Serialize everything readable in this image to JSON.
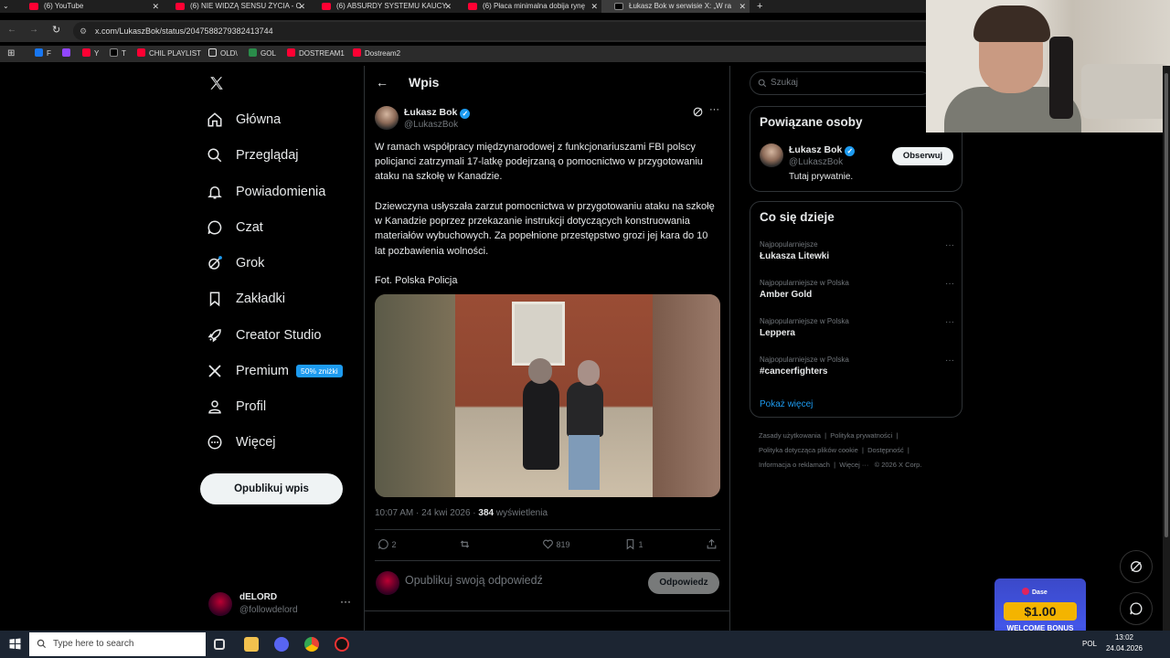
{
  "browser": {
    "tabs": [
      {
        "title": "(6) YouTube"
      },
      {
        "title": "(6) NIE WIDZĄ SENSU ŻYCIA - C"
      },
      {
        "title": "(6) ABSURDY SYSTEMU KAUCY"
      },
      {
        "title": "(6) Płaca minimalna dobija rynę"
      },
      {
        "title": "Łukasz Bok w serwisie X: „W ra"
      }
    ],
    "url": "x.com/LukaszBok/status/2047588279382413744",
    "bookmarks": [
      "F",
      "Y",
      "T",
      "CHIL PLAYLIST",
      "OLD\\",
      "GOL",
      "DOSTREAM1",
      "Dostream2"
    ]
  },
  "nav": {
    "items": [
      {
        "label": "Główna"
      },
      {
        "label": "Przeglądaj"
      },
      {
        "label": "Powiadomienia"
      },
      {
        "label": "Czat"
      },
      {
        "label": "Grok"
      },
      {
        "label": "Zakładki"
      },
      {
        "label": "Creator Studio"
      },
      {
        "label": "Premium"
      },
      {
        "label": "Profil"
      },
      {
        "label": "Więcej"
      }
    ],
    "premium_badge": "50% zniżki",
    "publish_label": "Opublikuj wpis",
    "account": {
      "name": "dELORD",
      "handle": "@followdelord"
    }
  },
  "post": {
    "header_title": "Wpis",
    "author": {
      "name": "Łukasz Bok",
      "handle": "@LukaszBok"
    },
    "paragraphs": [
      "W ramach współpracy międzynarodowej z funkcjonariuszami FBI polscy policjanci zatrzymali 17-latkę podejrzaną o pomocnictwo w przygotowaniu ataku na szkołę w Kanadzie.",
      "Dziewczyna usłyszała zarzut pomocnictwa w przygotowaniu ataku na szkołę w Kanadzie poprzez przekazanie instrukcji dotyczących konstruowania materiałów wybuchowych. Za popełnione przestępstwo grozi jej kara do 10 lat pozbawienia wolności.",
      "Fot. Polska Policja"
    ],
    "timestamp": "10:07 AM · 24 kwi 2026 · ",
    "views_count": "384",
    "views_label": " wyświetlenia",
    "actions": {
      "replies": "2",
      "reposts": "",
      "likes": "819",
      "bookmarks": "1"
    },
    "reply_placeholder": "Opublikuj swoją odpowiedź",
    "reply_button": "Odpowiedz"
  },
  "sidebar": {
    "search_placeholder": "Szukaj",
    "related": {
      "title": "Powiązane osoby",
      "name": "Łukasz Bok",
      "handle": "@LukaszBok",
      "bio": "Tutaj prywatnie.",
      "follow_label": "Obserwuj"
    },
    "trends": {
      "title": "Co się dzieje",
      "items": [
        {
          "context": "Najpopularniejsze",
          "topic": "Łukasza Litewki"
        },
        {
          "context": "Najpopularniejsze w Polska",
          "topic": "Amber Gold"
        },
        {
          "context": "Najpopularniejsze w Polska",
          "topic": "Leppera"
        },
        {
          "context": "Najpopularniejsze w Polska",
          "topic": "#cancerfighters"
        }
      ],
      "show_more": "Pokaż więcej"
    },
    "footer": [
      "Zasady użytkowania",
      "Polityka prywatności",
      "Polityka dotycząca plików cookie",
      "Dostępność",
      "Informacja o reklamach",
      "Więcej ···",
      "© 2026 X Corp."
    ]
  },
  "ad": {
    "brand": "Dase",
    "amount": "$1.00",
    "text": "WELCOME BONUS"
  },
  "taskbar": {
    "search_placeholder": "Type here to search",
    "lang": "POL",
    "time": "13:02",
    "date": "24.04.2026"
  },
  "colors": {
    "accent": "#1d9bf0",
    "bg": "#000000",
    "border": "#2f3336",
    "muted": "#71767b"
  }
}
